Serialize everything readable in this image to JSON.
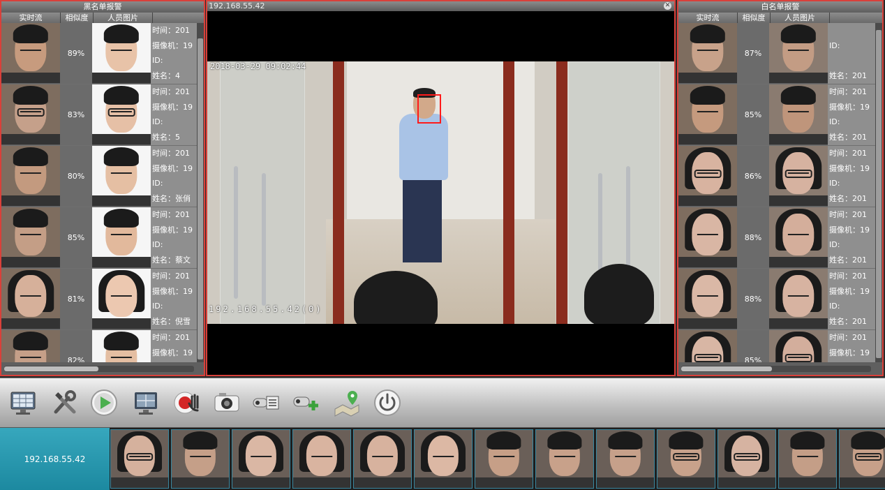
{
  "blacklist": {
    "title": "黑名单报警",
    "col_stream": "实时流",
    "col_similarity": "相似度",
    "col_photo": "人员图片",
    "rows": [
      {
        "similarity": "89%",
        "time": "时间：201",
        "camera": "摄像机：19",
        "id": "ID:",
        "name": "姓名：4",
        "snap_skin": "#c79b7e",
        "photo_skin": "#e8c3a8",
        "hair": "short",
        "glasses": false
      },
      {
        "similarity": "83%",
        "time": "时间：201",
        "camera": "摄像机：19",
        "id": "ID:",
        "name": "姓名：5",
        "snap_skin": "#c5a08a",
        "photo_skin": "#e6c0a6",
        "hair": "short",
        "glasses": true
      },
      {
        "similarity": "80%",
        "time": "时间：201",
        "camera": "摄像机：19",
        "id": "ID:",
        "name": "姓名：张俏",
        "snap_skin": "#c39a7f",
        "photo_skin": "#e5bfa3",
        "hair": "short",
        "glasses": false
      },
      {
        "similarity": "85%",
        "time": "时间：201",
        "camera": "摄像机：19",
        "id": "ID:",
        "name": "姓名：蔡文",
        "snap_skin": "#c49e86",
        "photo_skin": "#e2b99c",
        "hair": "short",
        "glasses": false
      },
      {
        "similarity": "81%",
        "time": "时间：201",
        "camera": "摄像机：19",
        "id": "ID:",
        "name": "姓名：倪雪",
        "snap_skin": "#d6b09a",
        "photo_skin": "#ecc8b0",
        "hair": "long",
        "glasses": false
      },
      {
        "similarity": "82%",
        "time": "时间：201",
        "camera": "摄像机：19",
        "id": "ID:",
        "name": "",
        "snap_skin": "#c59f88",
        "photo_skin": "#e4bea2",
        "hair": "short",
        "glasses": false
      }
    ]
  },
  "whitelist": {
    "title": "白名单报警",
    "col_stream": "实时流",
    "col_similarity": "相似度",
    "col_photo": "人员图片",
    "rows": [
      {
        "similarity": "87%",
        "time": "",
        "camera": "ID:",
        "id": "",
        "name": "姓名：201",
        "snap_skin": "#c8a28a",
        "photo_skin": "#c39c84",
        "hair": "short",
        "glasses": false
      },
      {
        "similarity": "85%",
        "time": "时间：201",
        "camera": "摄像机：19",
        "id": "ID:",
        "name": "姓名：201",
        "snap_skin": "#c59a7e",
        "photo_skin": "#bf957b",
        "hair": "short",
        "glasses": false
      },
      {
        "similarity": "86%",
        "time": "时间：201",
        "camera": "摄像机：19",
        "id": "ID:",
        "name": "姓名：201",
        "snap_skin": "#d8b3a0",
        "photo_skin": "#d6b2a0",
        "hair": "long",
        "glasses": true
      },
      {
        "similarity": "88%",
        "time": "时间：201",
        "camera": "摄像机：19",
        "id": "ID:",
        "name": "姓名：201",
        "snap_skin": "#d9b6a4",
        "photo_skin": "#d4ae9b",
        "hair": "long",
        "glasses": false
      },
      {
        "similarity": "88%",
        "time": "时间：201",
        "camera": "摄像机：19",
        "id": "ID:",
        "name": "姓名：201",
        "snap_skin": "#dab8a6",
        "photo_skin": "#d7b3a1",
        "hair": "long",
        "glasses": false
      },
      {
        "similarity": "85%",
        "time": "时间：201",
        "camera": "摄像机：19",
        "id": "ID:",
        "name": "姓名：201",
        "snap_skin": "#d8b6a4",
        "photo_skin": "#d3ae9c",
        "hair": "long",
        "glasses": true
      }
    ]
  },
  "video": {
    "title": "192.168.55.42",
    "timestamp": "2018-03-29 09:02:44",
    "channel_label": "192.168.55.42(0)"
  },
  "toolbar": {
    "icons": [
      "monitor-grid-icon",
      "tools-icon",
      "playback-icon",
      "screen-layout-icon",
      "record-stop-icon",
      "snapshot-camera-icon",
      "camera-list-icon",
      "add-camera-icon",
      "map-location-icon",
      "power-icon"
    ]
  },
  "strip": {
    "camera_label": "192.168.55.42",
    "faces": [
      {
        "skin": "#d5b19d",
        "hair": "long",
        "glasses": true
      },
      {
        "skin": "#c59f88",
        "hair": "short",
        "glasses": false
      },
      {
        "skin": "#dab7a4",
        "hair": "long",
        "glasses": false
      },
      {
        "skin": "#d9b4a0",
        "hair": "long",
        "glasses": false
      },
      {
        "skin": "#d7b29e",
        "hair": "long",
        "glasses": false
      },
      {
        "skin": "#dcb8a4",
        "hair": "long",
        "glasses": false
      },
      {
        "skin": "#c69f87",
        "hair": "short",
        "glasses": false
      },
      {
        "skin": "#c8a18a",
        "hair": "short",
        "glasses": false
      },
      {
        "skin": "#c6a08a",
        "hair": "short",
        "glasses": false
      },
      {
        "skin": "#c8a28b",
        "hair": "short",
        "glasses": true
      },
      {
        "skin": "#d6b3a1",
        "hair": "long",
        "glasses": true
      },
      {
        "skin": "#c49e87",
        "hair": "short",
        "glasses": false
      },
      {
        "skin": "#c7a089",
        "hair": "short",
        "glasses": true
      }
    ]
  }
}
